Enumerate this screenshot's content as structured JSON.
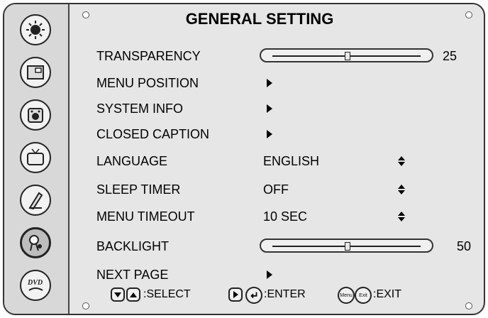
{
  "title": "GENERAL SETTING",
  "sidebar": {
    "items": [
      {
        "icon": "picture-settings-icon"
      },
      {
        "icon": "pip-icon"
      },
      {
        "icon": "audio-icon"
      },
      {
        "icon": "tv-channel-icon"
      },
      {
        "icon": "lock-icon"
      },
      {
        "icon": "general-setting-icon",
        "selected": true
      },
      {
        "icon": "dvd-icon"
      }
    ]
  },
  "menu": {
    "transparency": {
      "label": "TRANSPARENCY",
      "value": "25",
      "level": 25
    },
    "menu_position": {
      "label": "MENU POSITION"
    },
    "system_info": {
      "label": "SYSTEM INFO"
    },
    "closed_caption": {
      "label": "CLOSED CAPTION"
    },
    "language": {
      "label": "LANGUAGE",
      "value": "ENGLISH"
    },
    "sleep_timer": {
      "label": "SLEEP TIMER",
      "value": "OFF"
    },
    "menu_timeout": {
      "label": "MENU TIMEOUT",
      "value": "10 SEC"
    },
    "backlight": {
      "label": "BACKLIGHT",
      "value": "50",
      "level": 50
    },
    "next_page": {
      "label": "NEXT PAGE"
    }
  },
  "footer": {
    "select": ":SELECT",
    "enter": ":ENTER",
    "menu_key": "Menu",
    "exit_key": "Exit",
    "exit": ":EXIT"
  }
}
